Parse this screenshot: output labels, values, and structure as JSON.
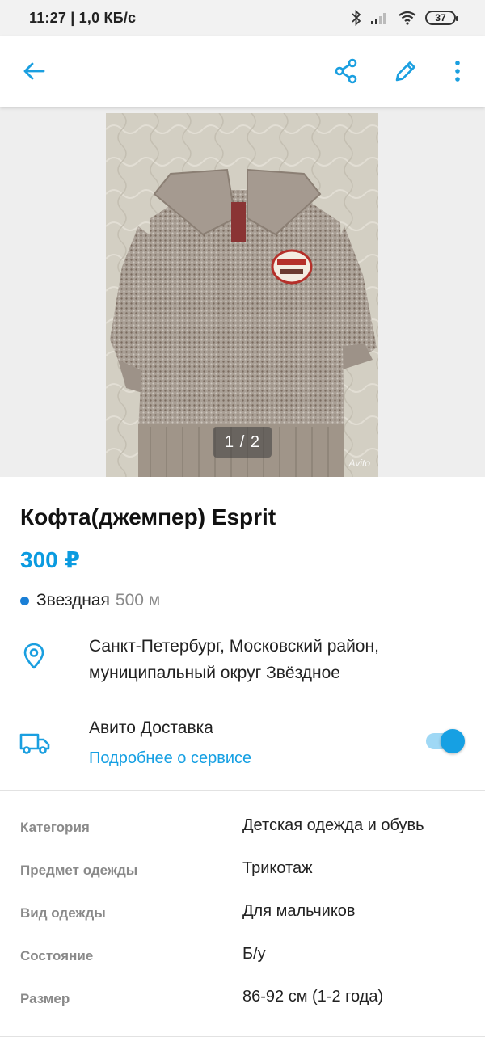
{
  "status_bar": {
    "time": "11:27 | 1,0 КБ/с",
    "battery": "37"
  },
  "toolbar": {
    "back_icon": "arrow-left-icon",
    "share_icon": "share-icon",
    "edit_icon": "pencil-icon",
    "more_icon": "more-vertical-icon",
    "accent_color": "#1a9fe0"
  },
  "gallery": {
    "counter": "1 / 2",
    "watermark": "Avito"
  },
  "listing": {
    "title": "Кофта(джемпер) Esprit",
    "price": "300 ₽",
    "metro_station": "Звездная",
    "metro_distance": "500 м",
    "metro_color": "#1a7fd6",
    "address": "Санкт-Петербург, Московский район, муниципальный округ Звёздное"
  },
  "delivery": {
    "title": "Авито Доставка",
    "link": "Подробнее о сервисе",
    "enabled": true
  },
  "params": [
    {
      "key": "Категория",
      "value": "Детская одежда и обувь"
    },
    {
      "key": "Предмет одежды",
      "value": "Трикотаж"
    },
    {
      "key": "Вид одежды",
      "value": "Для мальчиков"
    },
    {
      "key": "Состояние",
      "value": "Б/у"
    },
    {
      "key": "Размер",
      "value": "86-92 см (1-2 года)"
    }
  ]
}
